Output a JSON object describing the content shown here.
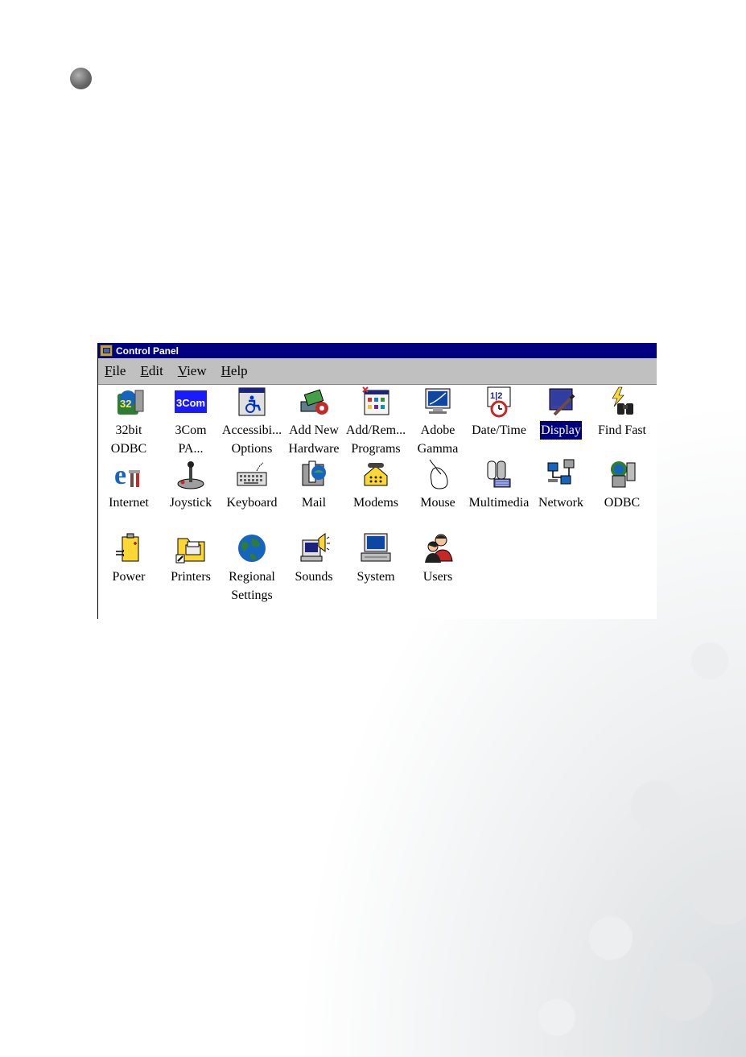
{
  "window": {
    "title": "Control Panel",
    "menu": [
      {
        "accel": "F",
        "rest": "ile"
      },
      {
        "accel": "E",
        "rest": "dit"
      },
      {
        "accel": "V",
        "rest": "iew"
      },
      {
        "accel": "H",
        "rest": "elp"
      }
    ]
  },
  "items": [
    {
      "label": "32bit\nODBC",
      "icon": "odbc32-icon"
    },
    {
      "label": "3Com\nPA...",
      "icon": "3com-icon"
    },
    {
      "label": "Accessibi...\nOptions",
      "icon": "accessibility-icon"
    },
    {
      "label": "Add New\nHardware",
      "icon": "add-hardware-icon"
    },
    {
      "label": "Add/Rem...\nPrograms",
      "icon": "add-remove-programs-icon"
    },
    {
      "label": "Adobe\nGamma",
      "icon": "adobe-gamma-icon"
    },
    {
      "label": "Date/Time",
      "icon": "date-time-icon"
    },
    {
      "label": "Display",
      "icon": "display-icon",
      "selected": true
    },
    {
      "label": "Find Fast",
      "icon": "find-fast-icon"
    },
    {
      "label": "Internet",
      "icon": "internet-icon"
    },
    {
      "label": "Joystick",
      "icon": "joystick-icon"
    },
    {
      "label": "Keyboard",
      "icon": "keyboard-icon"
    },
    {
      "label": "Mail",
      "icon": "mail-icon"
    },
    {
      "label": "Modems",
      "icon": "modems-icon"
    },
    {
      "label": "Mouse",
      "icon": "mouse-icon"
    },
    {
      "label": "Multimedia",
      "icon": "multimedia-icon"
    },
    {
      "label": "Network",
      "icon": "network-icon"
    },
    {
      "label": "ODBC",
      "icon": "odbc-icon"
    },
    {
      "label": "Power",
      "icon": "power-icon"
    },
    {
      "label": "Printers",
      "icon": "printers-icon"
    },
    {
      "label": "Regional\nSettings",
      "icon": "regional-settings-icon"
    },
    {
      "label": "Sounds",
      "icon": "sounds-icon"
    },
    {
      "label": "System",
      "icon": "system-icon"
    },
    {
      "label": "Users",
      "icon": "users-icon"
    }
  ],
  "colors": {
    "titlebar": "#000080",
    "menubar": "#c0c0c0",
    "selection": "#000080"
  }
}
